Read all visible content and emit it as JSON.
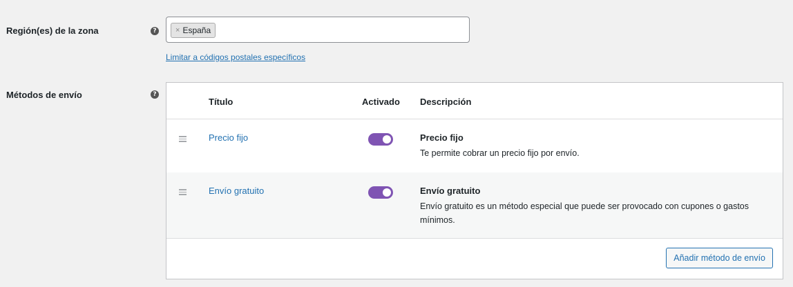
{
  "zone_regions": {
    "label": "Región(es) de la zona",
    "help": "?",
    "tokens": [
      {
        "remove": "×",
        "label": "España"
      }
    ],
    "limit_link": "Limitar a códigos postales específicos"
  },
  "shipping_methods": {
    "label": "Métodos de envío",
    "help": "?",
    "headers": {
      "title": "Título",
      "enabled": "Activado",
      "description": "Descripción"
    },
    "rows": [
      {
        "name": "Precio fijo",
        "enabled": true,
        "desc_title": "Precio fijo",
        "desc": "Te permite cobrar un precio fijo por envío."
      },
      {
        "name": "Envío gratuito",
        "enabled": true,
        "desc_title": "Envío gratuito",
        "desc": "Envío gratuito es un método especial que puede ser provocado con cupones o gastos mínimos."
      }
    ],
    "add_button": "Añadir método de envío"
  },
  "colors": {
    "accent": "#7f54b3",
    "link": "#2271b1"
  }
}
